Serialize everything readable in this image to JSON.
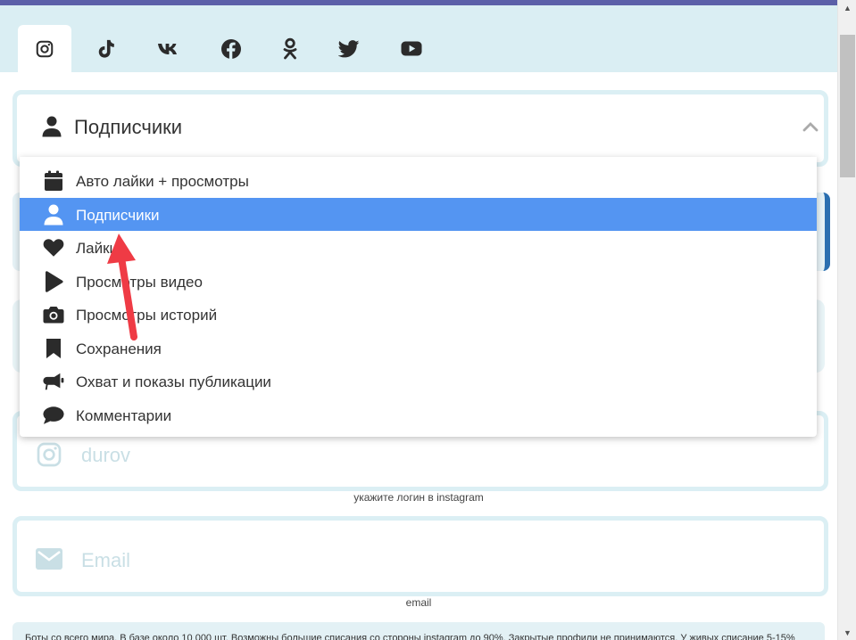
{
  "tabs": [
    {
      "name": "instagram",
      "icon": "instagram-icon",
      "active": true
    },
    {
      "name": "tiktok",
      "icon": "tiktok-icon",
      "active": false
    },
    {
      "name": "vk",
      "icon": "vk-icon",
      "active": false
    },
    {
      "name": "facebook",
      "icon": "facebook-icon",
      "active": false
    },
    {
      "name": "odnoklassniki",
      "icon": "odnoklassniki-icon",
      "active": false
    },
    {
      "name": "twitter",
      "icon": "twitter-icon",
      "active": false
    },
    {
      "name": "youtube",
      "icon": "youtube-icon",
      "active": false
    }
  ],
  "service_select": {
    "selected_label": "Подписчики",
    "icon": "user-icon",
    "toggle_icon": "chevron-up-icon"
  },
  "dropdown": {
    "items": [
      {
        "label": "Авто лайки + просмотры",
        "icon": "calendar-icon",
        "selected": false
      },
      {
        "label": "Подписчики",
        "icon": "user-icon",
        "selected": true
      },
      {
        "label": "Лайки",
        "icon": "heart-icon",
        "selected": false
      },
      {
        "label": "Просмотры видео",
        "icon": "play-icon",
        "selected": false
      },
      {
        "label": "Просмотры историй",
        "icon": "camera-icon",
        "selected": false
      },
      {
        "label": "Сохранения",
        "icon": "bookmark-icon",
        "selected": false
      },
      {
        "label": "Охват и показы публикации",
        "icon": "megaphone-icon",
        "selected": false
      },
      {
        "label": "Комментарии",
        "icon": "comment-icon",
        "selected": false
      }
    ]
  },
  "login_field": {
    "placeholder": "durov",
    "icon": "instagram-icon",
    "help": "укажите логин в instagram"
  },
  "email_field": {
    "placeholder": "Email",
    "icon": "envelope-icon",
    "help": "email"
  },
  "notice": {
    "text": "Боты со всего мира. В базе около 10 000 шт. Возможны большие списания со стороны instagram до 90%. Закрытые профили не принимаются. У живых списание 5-15%"
  },
  "colors": {
    "accent": "#5495f2",
    "tab_bar": "#daeef3",
    "border": "#dbeff4",
    "top_bar": "#5b5fa8",
    "annotation_arrow": "#ef3b45"
  }
}
